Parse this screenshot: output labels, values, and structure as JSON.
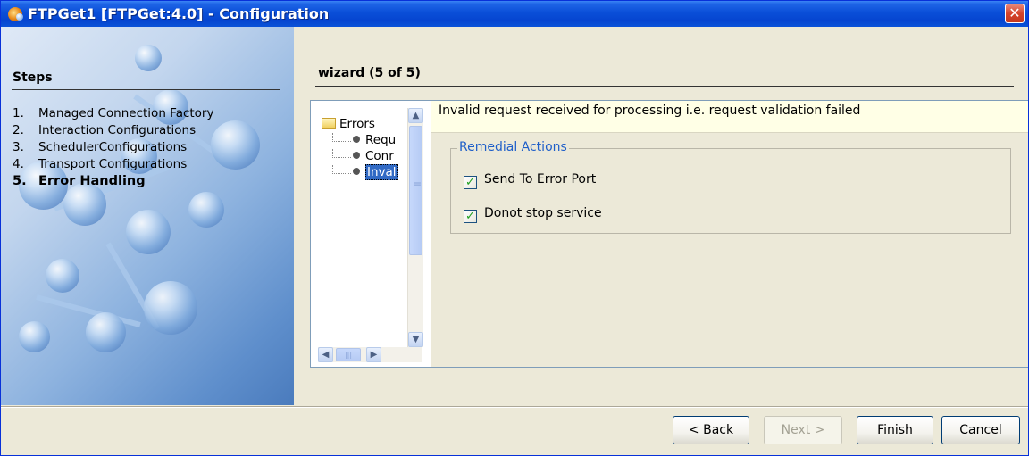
{
  "window": {
    "title": "FTPGet1 [FTPGet:4.0] - Configuration",
    "close_label": "✕"
  },
  "steps": {
    "title": "Steps",
    "items": [
      {
        "num": "1.",
        "label": "Managed Connection Factory"
      },
      {
        "num": "2.",
        "label": "Interaction Configurations"
      },
      {
        "num": "3.",
        "label": "SchedulerConfigurations"
      },
      {
        "num": "4.",
        "label": "Transport Configurations"
      },
      {
        "num": "5.",
        "label": "Error Handling",
        "current": true
      }
    ]
  },
  "wizard": {
    "title": "wizard (5 of 5)"
  },
  "tree": {
    "root_label": "Errors",
    "nodes": [
      "Requ",
      "Conr",
      "Inval"
    ],
    "selected_index": 2
  },
  "detail": {
    "description": "Invalid request received for processing i.e. request validation failed",
    "group_label": "Remedial Actions",
    "options": [
      {
        "label": "Send To Error Port",
        "checked": true
      },
      {
        "label": "Donot stop service",
        "checked": true
      }
    ]
  },
  "buttons": {
    "back": "< Back",
    "next": "Next >",
    "finish": "Finish",
    "cancel": "Cancel"
  },
  "colors": {
    "titlebar": "#0a4fd8",
    "legend": "#1f5fc9",
    "selection": "#316ac5",
    "check": "#21a121"
  }
}
